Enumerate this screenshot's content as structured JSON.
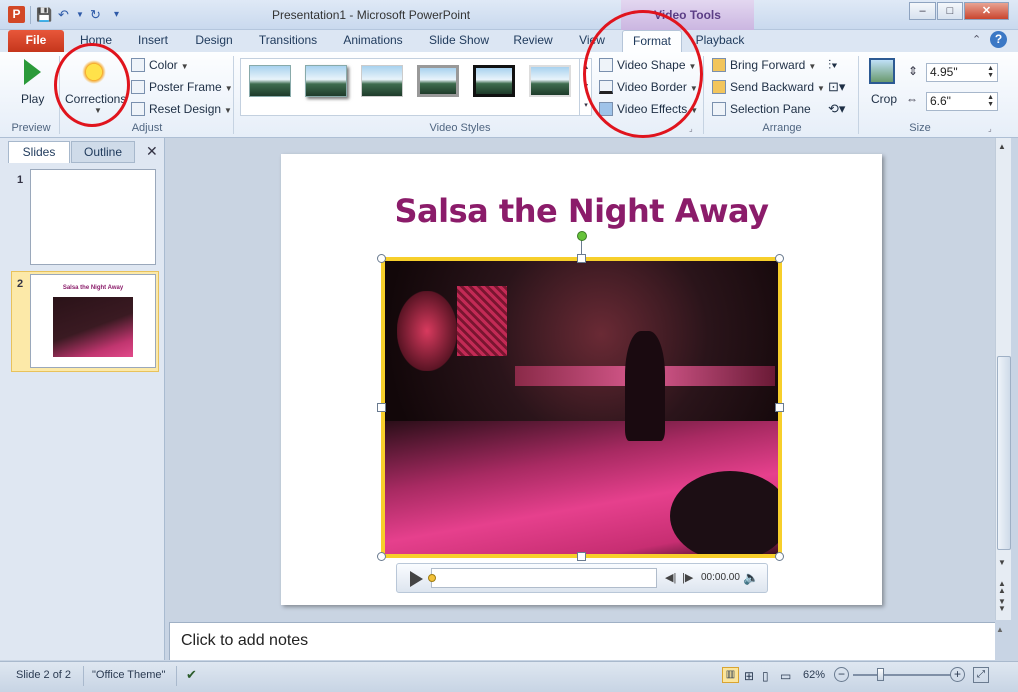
{
  "window": {
    "title": "Presentation1 - Microsoft PowerPoint",
    "context_tab_title": "Video Tools",
    "app_icon": "P",
    "minimize": "–",
    "restore": "□",
    "close": "✕"
  },
  "tabs": [
    "File",
    "Home",
    "Insert",
    "Design",
    "Transitions",
    "Animations",
    "Slide Show",
    "Review",
    "View",
    "Format",
    "Playback"
  ],
  "ribbon": {
    "preview": {
      "play_label": "Play",
      "group": "Preview"
    },
    "adjust": {
      "corrections_label": "Corrections",
      "color_label": "Color",
      "poster_frame_label": "Poster Frame",
      "reset_design_label": "Reset Design",
      "group": "Adjust"
    },
    "video_styles": {
      "group": "Video Styles"
    },
    "video_format": {
      "shape_label": "Video Shape",
      "border_label": "Video Border",
      "effects_label": "Video Effects"
    },
    "arrange": {
      "bring_forward": "Bring Forward",
      "send_backward": "Send Backward",
      "selection_pane": "Selection Pane",
      "group": "Arrange"
    },
    "size": {
      "crop_label": "Crop",
      "height": "4.95\"",
      "width": "6.6\"",
      "group": "Size"
    }
  },
  "left_pane": {
    "tab_slides": "Slides",
    "tab_outline": "Outline",
    "close": "✕",
    "slide1_num": "1",
    "slide2_num": "2",
    "slide2_title": "Salsa the Night Away"
  },
  "slide": {
    "title": "Salsa the Night Away"
  },
  "player": {
    "time": "00:00.00"
  },
  "notes": {
    "placeholder": "Click to add notes"
  },
  "status": {
    "slide_of": "Slide 2 of 2",
    "theme": "\"Office Theme\"",
    "zoom": "62%",
    "zoom_out": "−",
    "zoom_in": "+"
  },
  "colors": {
    "accent_file": "#c5361c",
    "title_color": "#8b1c6a",
    "selection": "#f7cf2b",
    "annotation": "#e0141d"
  }
}
